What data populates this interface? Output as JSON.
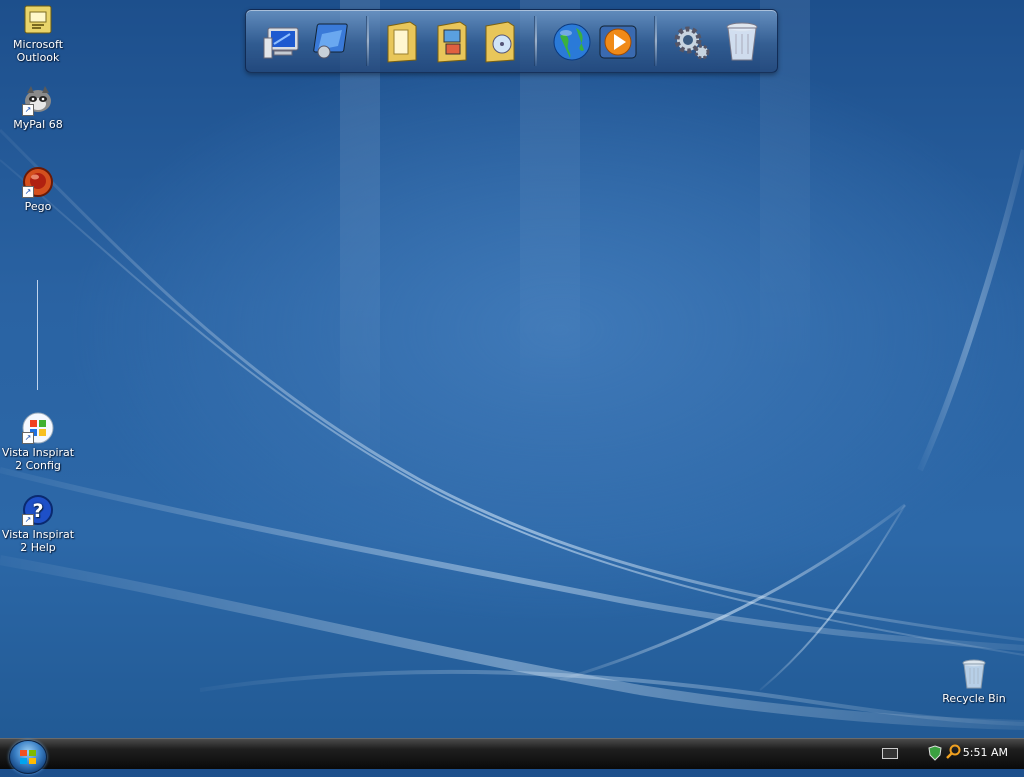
{
  "desktop": {
    "icons": [
      {
        "label": "Microsoft Outlook",
        "icon": "outlook-icon"
      },
      {
        "label": "MyPal 68",
        "icon": "raccoon-browser-icon"
      },
      {
        "label": "Pego",
        "icon": "pego-icon"
      },
      {
        "label": "Vista Inspirat 2 Config",
        "icon": "windows-flag-icon"
      },
      {
        "label": "Vista Inspirat 2 Help",
        "icon": "help-icon"
      },
      {
        "label": "Recycle Bin",
        "icon": "recycle-bin-icon"
      }
    ]
  },
  "dock": {
    "items": [
      "my-computer-icon",
      "control-panel-icon",
      "documents-folder-icon",
      "pictures-folder-icon",
      "music-folder-icon",
      "internet-globe-icon",
      "media-player-icon",
      "settings-gears-icon",
      "trash-icon"
    ]
  },
  "taskbar": {
    "start_label": "Start",
    "clock": "5:51 AM",
    "tray_icons": [
      "keyboard-icon",
      "security-shield-icon",
      "search-magnifier-icon"
    ]
  },
  "colors": {
    "desktop_blue": "#2a63a3",
    "taskbar_black": "#0a0a0a",
    "accent_light": "#9cd0f5"
  }
}
